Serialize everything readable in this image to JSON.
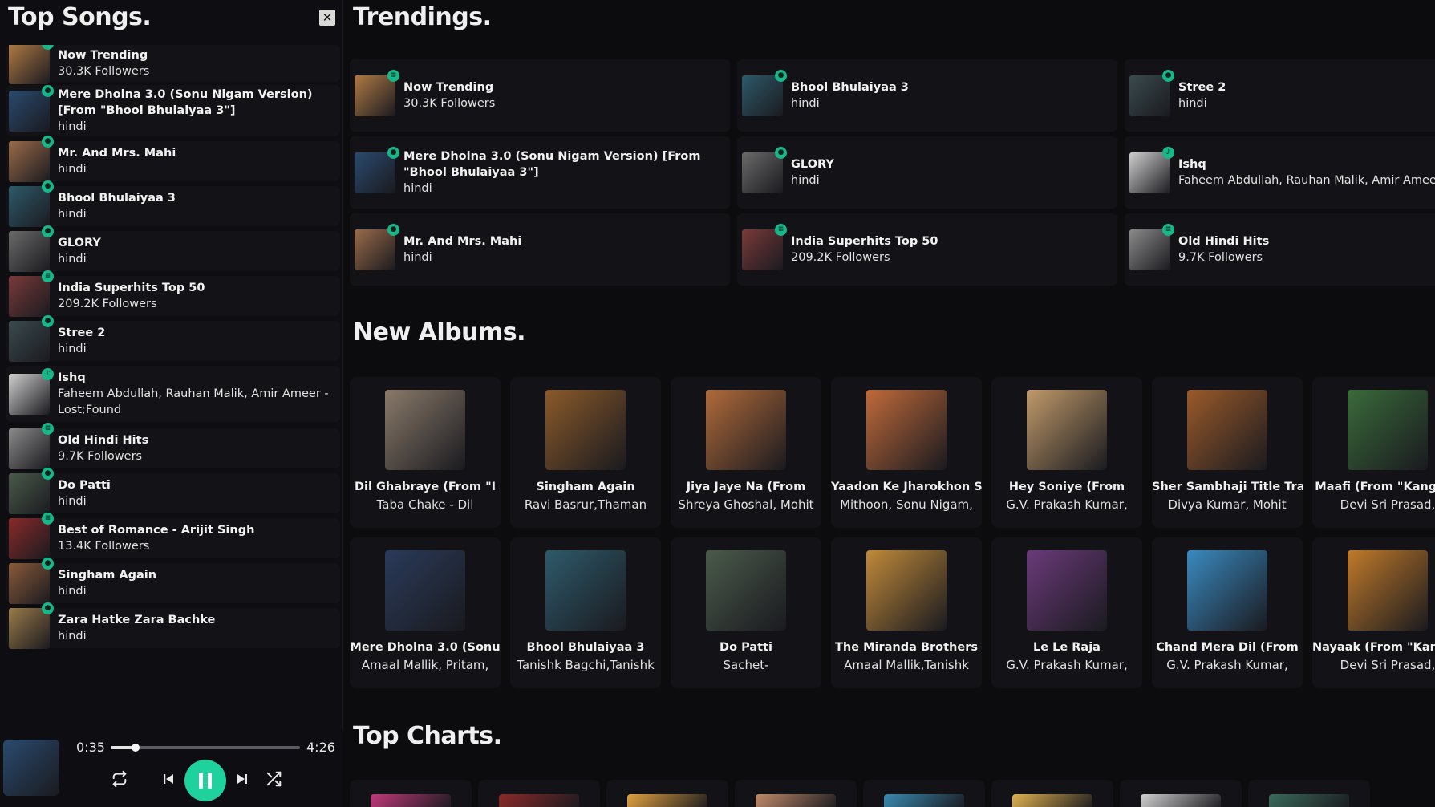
{
  "sidebar": {
    "title": "Top Songs.",
    "close_label": "✕",
    "songs": [
      {
        "title": "Now Trending",
        "subtitle": "30.3K Followers",
        "badge": "≡",
        "color": "#b07a45"
      },
      {
        "title": "Mere Dholna 3.0 (Sonu Nigam Version) [From \"Bhool Bhulaiyaa 3\"]",
        "subtitle": "hindi",
        "badge": "●",
        "color": "#2a4a6e"
      },
      {
        "title": "Mr. And Mrs. Mahi",
        "subtitle": "hindi",
        "badge": "●",
        "color": "#9a6b4a"
      },
      {
        "title": "Bhool Bhulaiyaa 3",
        "subtitle": "hindi",
        "badge": "●",
        "color": "#2e5a6a"
      },
      {
        "title": "GLORY",
        "subtitle": "hindi",
        "badge": "●",
        "color": "#6a6a6a"
      },
      {
        "title": "India Superhits Top 50",
        "subtitle": "209.2K Followers",
        "badge": "≡",
        "color": "#7a3a3a"
      },
      {
        "title": "Stree 2",
        "subtitle": "hindi",
        "badge": "●",
        "color": "#3a4a4e"
      },
      {
        "title": "Ishq",
        "subtitle": "Faheem Abdullah, Rauhan Malik, Amir Ameer - Lost;Found",
        "badge": "♪",
        "color": "#cfcfcf"
      },
      {
        "title": "Old Hindi Hits",
        "subtitle": "9.7K Followers",
        "badge": "≡",
        "color": "#8a8a8a"
      },
      {
        "title": "Do Patti",
        "subtitle": "hindi",
        "badge": "●",
        "color": "#4a5a4a"
      },
      {
        "title": "Best of Romance - Arijit Singh",
        "subtitle": "13.4K Followers",
        "badge": "≡",
        "color": "#8a2a2a"
      },
      {
        "title": "Singham Again",
        "subtitle": "hindi",
        "badge": "●",
        "color": "#8a5a3a"
      },
      {
        "title": "Zara Hatke Zara Bachke",
        "subtitle": "hindi",
        "badge": "●",
        "color": "#9a7a4a"
      }
    ]
  },
  "player": {
    "current_time": "0:35",
    "total_time": "4:26",
    "progress": 0.13,
    "art_color": "#2a4a6e"
  },
  "trendings": {
    "title": "Trendings.",
    "cards": [
      {
        "title": "Now Trending",
        "subtitle": "30.3K Followers",
        "badge": "≡",
        "color": "#b07a45"
      },
      {
        "title": "Bhool Bhulaiyaa 3",
        "subtitle": "hindi",
        "badge": "●",
        "color": "#2e5a6a"
      },
      {
        "title": "Stree 2",
        "subtitle": "hindi",
        "badge": "●",
        "color": "#3a4a4e"
      },
      {
        "title": "Mere Dholna 3.0 (Sonu Nigam Version) [From \"Bhool Bhulaiyaa 3\"]",
        "subtitle": "hindi",
        "badge": "●",
        "color": "#2a4a6e"
      },
      {
        "title": "GLORY",
        "subtitle": "hindi",
        "badge": "●",
        "color": "#6a6a6a"
      },
      {
        "title": "Ishq",
        "subtitle": "Faheem Abdullah, Rauhan Malik, Amir Ameer - Lo",
        "badge": "♪",
        "color": "#cfcfcf"
      },
      {
        "title": "Mr. And Mrs. Mahi",
        "subtitle": "hindi",
        "badge": "●",
        "color": "#9a6b4a"
      },
      {
        "title": "India Superhits Top 50",
        "subtitle": "209.2K Followers",
        "badge": "≡",
        "color": "#7a3a3a"
      },
      {
        "title": "Old Hindi Hits",
        "subtitle": "9.7K Followers",
        "badge": "≡",
        "color": "#8a8a8a"
      }
    ]
  },
  "new_albums": {
    "title": "New Albums.",
    "albums": [
      {
        "title": "Dil Ghabraye (From \"I",
        "subtitle": "Taba Chake - Dil",
        "color": "#8a7a6a"
      },
      {
        "title": "Singham Again",
        "subtitle": "Ravi Basrur,Thaman",
        "color": "#8a5a2a"
      },
      {
        "title": "Jiya Jaye Na (From",
        "subtitle": "Shreya Ghoshal, Mohit",
        "color": "#b06a3a"
      },
      {
        "title": "Yaadon Ke Jharokhon Se",
        "subtitle": "Mithoon, Sonu Nigam,",
        "color": "#c06a3a"
      },
      {
        "title": "Hey Soniye (From",
        "subtitle": "G.V. Prakash Kumar,",
        "color": "#c09a6a"
      },
      {
        "title": "Sher Sambhaji Title Track",
        "subtitle": "Divya Kumar, Mohit",
        "color": "#9a5a2a"
      },
      {
        "title": "Maafi (From \"Kanguva",
        "subtitle": "Devi Sri Prasad,",
        "color": "#3a6a3a"
      },
      {
        "title": "Mere Dholna 3.0 (Sonu",
        "subtitle": "Amaal Mallik, Pritam,",
        "color": "#2a3a5a"
      },
      {
        "title": "Bhool Bhulaiyaa 3",
        "subtitle": "Tanishk Bagchi,Tanishk",
        "color": "#2e5a6a"
      },
      {
        "title": "Do Patti",
        "subtitle": "Sachet-",
        "color": "#4a5a4a"
      },
      {
        "title": "The Miranda Brothers",
        "subtitle": "Amaal Mallik,Tanishk",
        "color": "#c08a3a"
      },
      {
        "title": "Le Le Raja",
        "subtitle": "G.V. Prakash Kumar,",
        "color": "#6a3a7a"
      },
      {
        "title": "Chand Mera Dil (From",
        "subtitle": "G.V. Prakash Kumar,",
        "color": "#3a8ac0"
      },
      {
        "title": "Nayaak (From \"Kanguva",
        "subtitle": "Devi Sri Prasad,",
        "color": "#c07a2a"
      }
    ]
  },
  "top_charts": {
    "title": "Top Charts.",
    "charts": [
      {
        "color": "#c03a7a"
      },
      {
        "color": "#8a2a2a"
      },
      {
        "color": "#e0a040"
      },
      {
        "color": "#c08a6a"
      },
      {
        "color": "#3a8ab0"
      },
      {
        "color": "#e0b050"
      },
      {
        "color": "#d0d0d0"
      },
      {
        "color": "#3a6a5a"
      }
    ]
  },
  "colors": {
    "accent": "#1ed19d",
    "badge": "#16b88a",
    "background": "#0c0c0f",
    "card": "#131317"
  }
}
